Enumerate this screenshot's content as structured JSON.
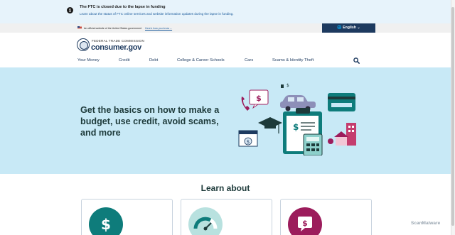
{
  "alert": {
    "title": "The FTC is closed due to the lapse in funding",
    "description": "Learn about the status of FTC online services and website information updates during the lapse in funding."
  },
  "gov_banner": {
    "official_text": "An official website of the United States government",
    "how_know": "Here's how you know ⌄"
  },
  "language": {
    "label": "🌐 English ⌄"
  },
  "header": {
    "agency": "FEDERAL TRADE COMMISSION",
    "brand": "consumer.gov"
  },
  "nav": {
    "items": [
      {
        "label": "Your Money"
      },
      {
        "label": "Credit"
      },
      {
        "label": "Debt"
      },
      {
        "label": "College & Career Schools"
      },
      {
        "label": "Cars"
      },
      {
        "label": "Scams & Identity Theft"
      }
    ]
  },
  "hero": {
    "heading": "Get the basics on how to make a budget, use credit, avoid scams, and more"
  },
  "learn": {
    "heading": "Learn about",
    "cards": [
      {
        "icon": "dollar-icon",
        "color": "#0e7c7b"
      },
      {
        "icon": "credit-gauge-icon",
        "color": "#b8e1df"
      },
      {
        "icon": "chat-dollar-icon",
        "color": "#9c1c5c"
      }
    ]
  },
  "watermark": {
    "text": "ScanMalware"
  },
  "colors": {
    "navy": "#1d3a5f",
    "teal": "#0e7c7b",
    "magenta": "#9c1c5c",
    "hero_bg": "#c8e9f6",
    "alert_bg": "#e7f3fb"
  }
}
